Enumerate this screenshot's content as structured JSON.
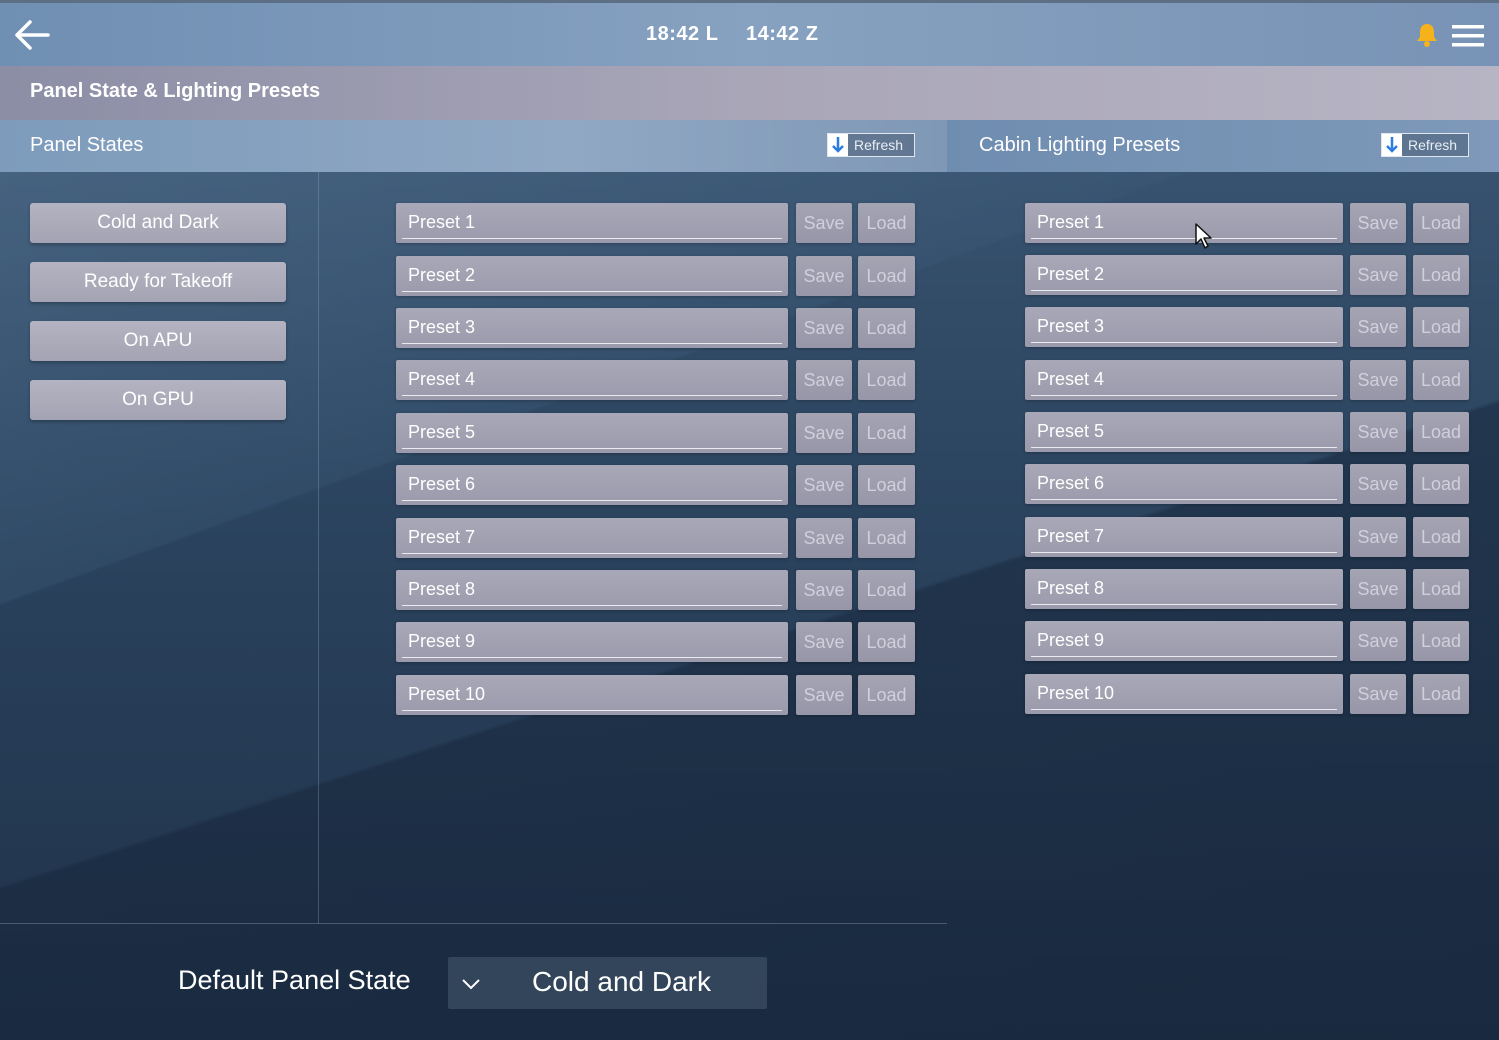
{
  "topbar": {
    "local_time": "18:42 L",
    "zulu_time": "14:42 Z",
    "back_icon": "arrow-left-icon",
    "bell_icon": "bell-icon",
    "bell_color": "#f5b21b",
    "menu_icon": "hamburger-menu-icon"
  },
  "page_title": "Panel State & Lighting Presets",
  "panel_states": {
    "header": "Panel States",
    "refresh_label": "Refresh",
    "buttons": [
      "Cold and Dark",
      "Ready for Takeoff",
      "On APU",
      "On GPU"
    ],
    "presets": [
      {
        "name": "Preset 1",
        "save": "Save",
        "load": "Load"
      },
      {
        "name": "Preset 2",
        "save": "Save",
        "load": "Load"
      },
      {
        "name": "Preset 3",
        "save": "Save",
        "load": "Load"
      },
      {
        "name": "Preset 4",
        "save": "Save",
        "load": "Load"
      },
      {
        "name": "Preset 5",
        "save": "Save",
        "load": "Load"
      },
      {
        "name": "Preset 6",
        "save": "Save",
        "load": "Load"
      },
      {
        "name": "Preset 7",
        "save": "Save",
        "load": "Load"
      },
      {
        "name": "Preset 8",
        "save": "Save",
        "load": "Load"
      },
      {
        "name": "Preset 9",
        "save": "Save",
        "load": "Load"
      },
      {
        "name": "Preset 10",
        "save": "Save",
        "load": "Load"
      }
    ]
  },
  "cabin_lighting": {
    "header": "Cabin Lighting Presets",
    "refresh_label": "Refresh",
    "presets": [
      {
        "name": "Preset 1",
        "save": "Save",
        "load": "Load"
      },
      {
        "name": "Preset 2",
        "save": "Save",
        "load": "Load"
      },
      {
        "name": "Preset 3",
        "save": "Save",
        "load": "Load"
      },
      {
        "name": "Preset 4",
        "save": "Save",
        "load": "Load"
      },
      {
        "name": "Preset 5",
        "save": "Save",
        "load": "Load"
      },
      {
        "name": "Preset 6",
        "save": "Save",
        "load": "Load"
      },
      {
        "name": "Preset 7",
        "save": "Save",
        "load": "Load"
      },
      {
        "name": "Preset 8",
        "save": "Save",
        "load": "Load"
      },
      {
        "name": "Preset 9",
        "save": "Save",
        "load": "Load"
      },
      {
        "name": "Preset 10",
        "save": "Save",
        "load": "Load"
      }
    ]
  },
  "default_panel_state": {
    "label": "Default Panel State",
    "selected": "Cold and Dark"
  }
}
